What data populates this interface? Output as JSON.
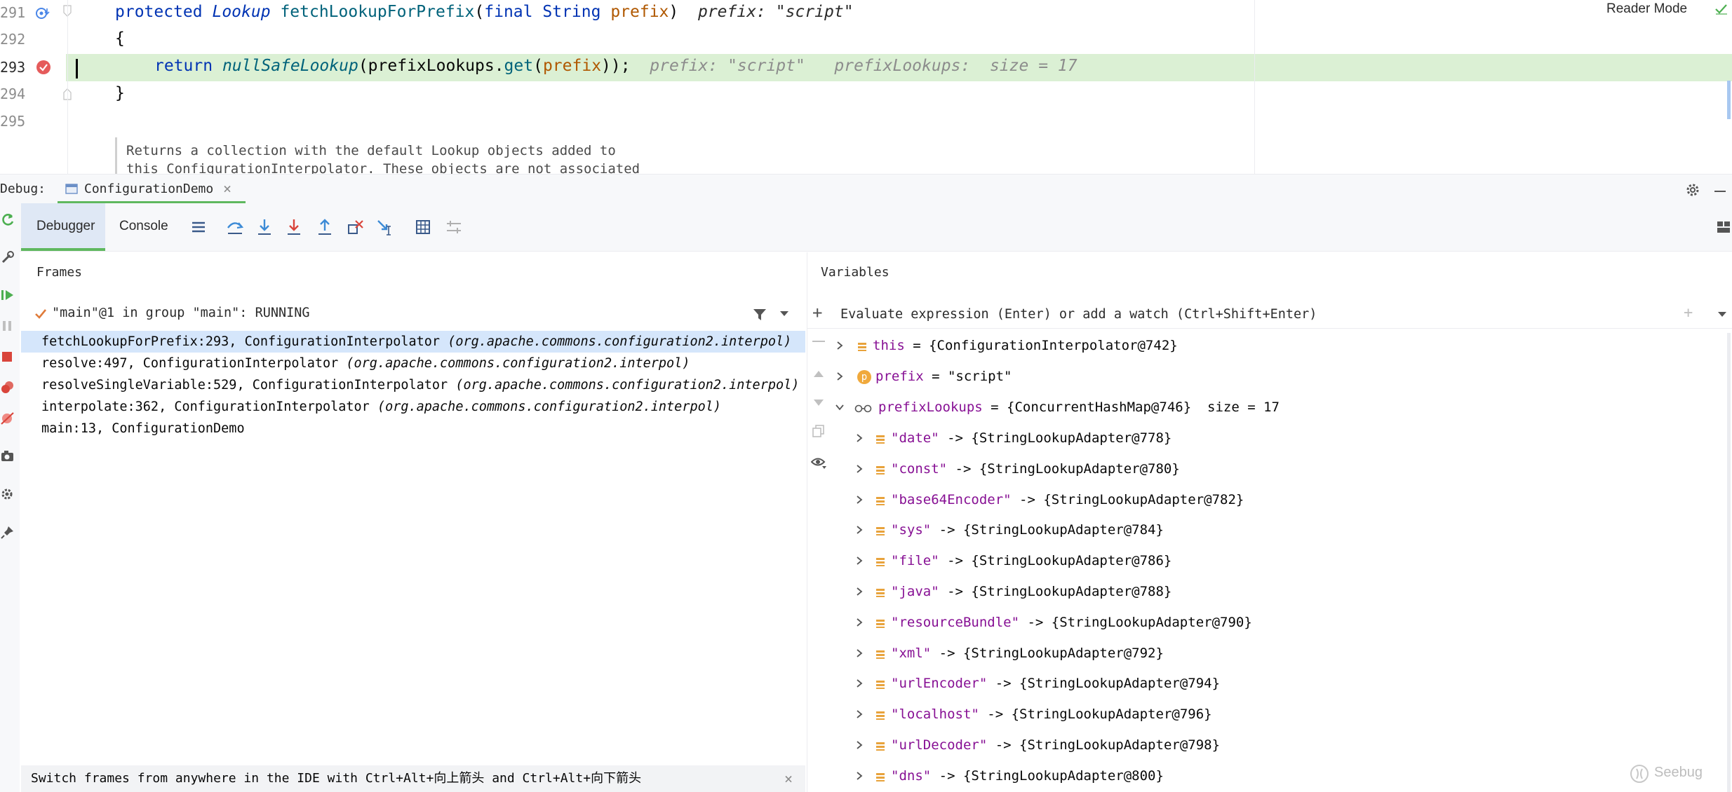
{
  "editor": {
    "reader_mode": "Reader Mode",
    "lines": [
      {
        "num": "291"
      },
      {
        "num": "292"
      },
      {
        "num": "293"
      },
      {
        "num": "294"
      },
      {
        "num": "295"
      }
    ],
    "line291": {
      "protected": "protected",
      "type": "Lookup",
      "method": "fetchLookupForPrefix",
      "open": "(",
      "final": "final",
      "string": "String",
      "param": "prefix",
      "close": ")",
      "hint_name": "prefix:",
      "hint_value": "\"script\""
    },
    "line292": "{",
    "line293": {
      "return": "return",
      "call": "nullSafeLookup",
      "rest1": "(prefixLookups.",
      "get": "get",
      "open": "(",
      "param": "prefix",
      "rest2": "));",
      "hint1": "prefix: \"script\"",
      "hint2": "prefixLookups:  size = 17"
    },
    "line294": "}",
    "doc_line1": "Returns a collection with the default Lookup objects added to",
    "doc_line2": "this ConfigurationInterpolator. These objects are not associated"
  },
  "debug": {
    "label": "Debug:",
    "session_tab": "ConfigurationDemo",
    "tabs": {
      "debugger": "Debugger",
      "console": "Console"
    }
  },
  "frames": {
    "title": "Frames",
    "thread": "\"main\"@1 in group \"main\": RUNNING",
    "items": [
      {
        "method": "fetchLookupForPrefix:293, ConfigurationInterpolator ",
        "pkg": "(org.apache.commons.configuration2.interpol)"
      },
      {
        "method": "resolve:497, ConfigurationInterpolator ",
        "pkg": "(org.apache.commons.configuration2.interpol)"
      },
      {
        "method": "resolveSingleVariable:529, ConfigurationInterpolator ",
        "pkg": "(org.apache.commons.configuration2.interpol)"
      },
      {
        "method": "interpolate:362, ConfigurationInterpolator ",
        "pkg": "(org.apache.commons.configuration2.interpol)"
      },
      {
        "method": "main:13, ConfigurationDemo",
        "pkg": ""
      }
    ],
    "hint": "Switch frames from anywhere in the IDE with Ctrl+Alt+向上箭头 and Ctrl+Alt+向下箭头"
  },
  "variables": {
    "title": "Variables",
    "evaluate_placeholder": "Evaluate expression (Enter) or add a watch (Ctrl+Shift+Enter)",
    "this": {
      "name": "this",
      "value": " = {ConfigurationInterpolator@742}"
    },
    "prefix": {
      "badge": "p",
      "name": "prefix",
      "value": " = \"script\""
    },
    "prefixLookups": {
      "name": "prefixLookups",
      "value": " = {ConcurrentHashMap@746}  size = 17"
    },
    "entries": [
      {
        "key": "\"date\"",
        "value": " -> {StringLookupAdapter@778}"
      },
      {
        "key": "\"const\"",
        "value": " -> {StringLookupAdapter@780}"
      },
      {
        "key": "\"base64Encoder\"",
        "value": " -> {StringLookupAdapter@782}"
      },
      {
        "key": "\"sys\"",
        "value": " -> {StringLookupAdapter@784}"
      },
      {
        "key": "\"file\"",
        "value": " -> {StringLookupAdapter@786}"
      },
      {
        "key": "\"java\"",
        "value": " -> {StringLookupAdapter@788}"
      },
      {
        "key": "\"resourceBundle\"",
        "value": " -> {StringLookupAdapter@790}"
      },
      {
        "key": "\"xml\"",
        "value": " -> {StringLookupAdapter@792}"
      },
      {
        "key": "\"urlEncoder\"",
        "value": " -> {StringLookupAdapter@794}"
      },
      {
        "key": "\"localhost\"",
        "value": " -> {StringLookupAdapter@796}"
      },
      {
        "key": "\"urlDecoder\"",
        "value": " -> {StringLookupAdapter@798}"
      },
      {
        "key": "\"dns\"",
        "value": " -> {StringLookupAdapter@800}"
      }
    ]
  },
  "watermark": "Seebug",
  "colors": {
    "accent": "#4a86e8",
    "selection": "#d5e6fb",
    "current_line": "#dbf0d4",
    "keyword": "#0033b3",
    "variable": "#871094"
  }
}
